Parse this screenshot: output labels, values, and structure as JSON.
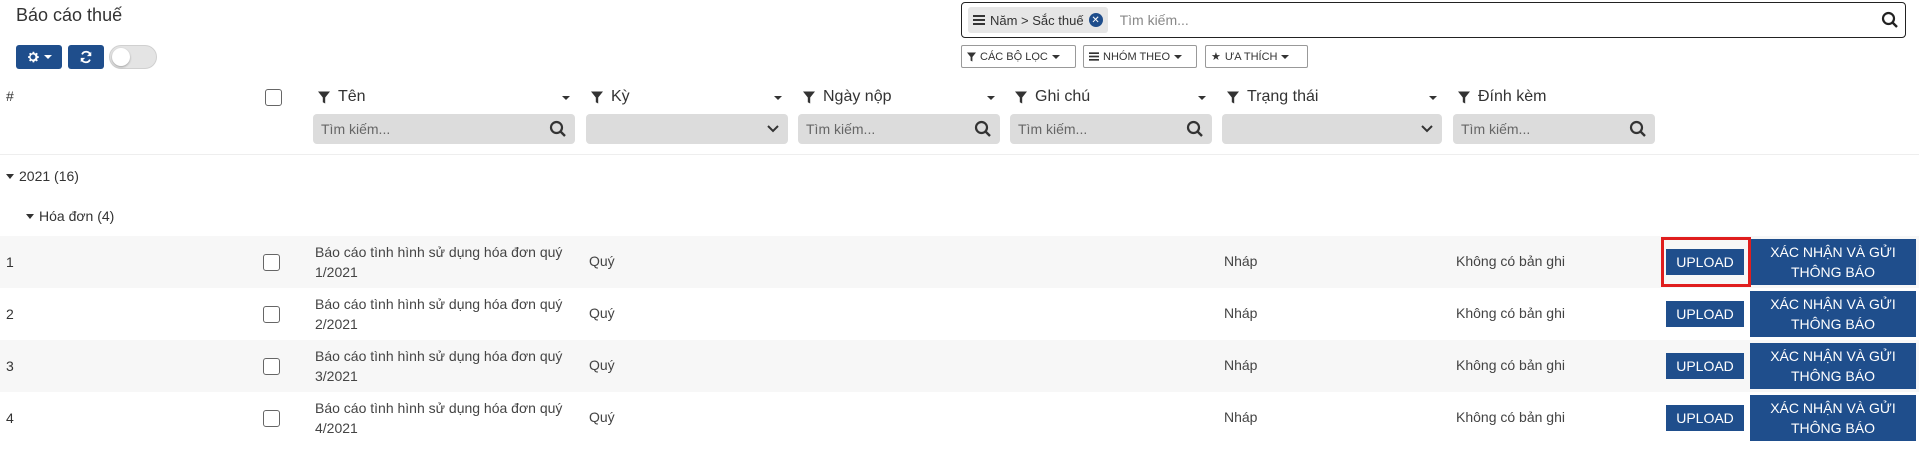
{
  "page": {
    "title": "Báo cáo thuế"
  },
  "search": {
    "facet_label": "Năm > Sắc thuế",
    "placeholder": "Tìm kiếm..."
  },
  "filters": {
    "filters_label": "CÁC BỘ LỌC",
    "group_by_label": "NHÓM THEO",
    "favorites_label": "ƯA THÍCH"
  },
  "table": {
    "hash": "#",
    "columns": [
      {
        "label": "Tên",
        "filter": "search",
        "placeholder": "Tìm kiếm..."
      },
      {
        "label": "Kỳ",
        "filter": "select",
        "placeholder": ""
      },
      {
        "label": "Ngày nộp",
        "filter": "search",
        "placeholder": "Tìm kiếm..."
      },
      {
        "label": "Ghi chú",
        "filter": "search",
        "placeholder": "Tìm kiếm..."
      },
      {
        "label": "Trạng thái",
        "filter": "select",
        "placeholder": ""
      },
      {
        "label": "Đính kèm",
        "filter": "search",
        "placeholder": "Tìm kiếm..."
      }
    ],
    "groups": {
      "year": "2021 (16)",
      "subgroup": "Hóa đơn (4)"
    },
    "rows": [
      {
        "num": "1",
        "name": "Báo cáo tình hình sử dụng hóa đơn quý 1/2021",
        "ky": "Quý",
        "status": "Nháp",
        "attachment": "Không có bản ghi"
      },
      {
        "num": "2",
        "name": "Báo cáo tình hình sử dụng hóa đơn quý 2/2021",
        "ky": "Quý",
        "status": "Nháp",
        "attachment": "Không có bản ghi"
      },
      {
        "num": "3",
        "name": "Báo cáo tình hình sử dụng hóa đơn quý 3/2021",
        "ky": "Quý",
        "status": "Nháp",
        "attachment": "Không có bản ghi"
      },
      {
        "num": "4",
        "name": "Báo cáo tình hình sử dụng hóa đơn quý 4/2021",
        "ky": "Quý",
        "status": "Nháp",
        "attachment": "Không có bản ghi"
      }
    ],
    "upload_label": "UPLOAD",
    "confirm_label": "XÁC NHẬN VÀ GỬI THÔNG BÁO"
  },
  "colors": {
    "primary": "#1f4e8c",
    "highlight": "#e01e1e"
  }
}
